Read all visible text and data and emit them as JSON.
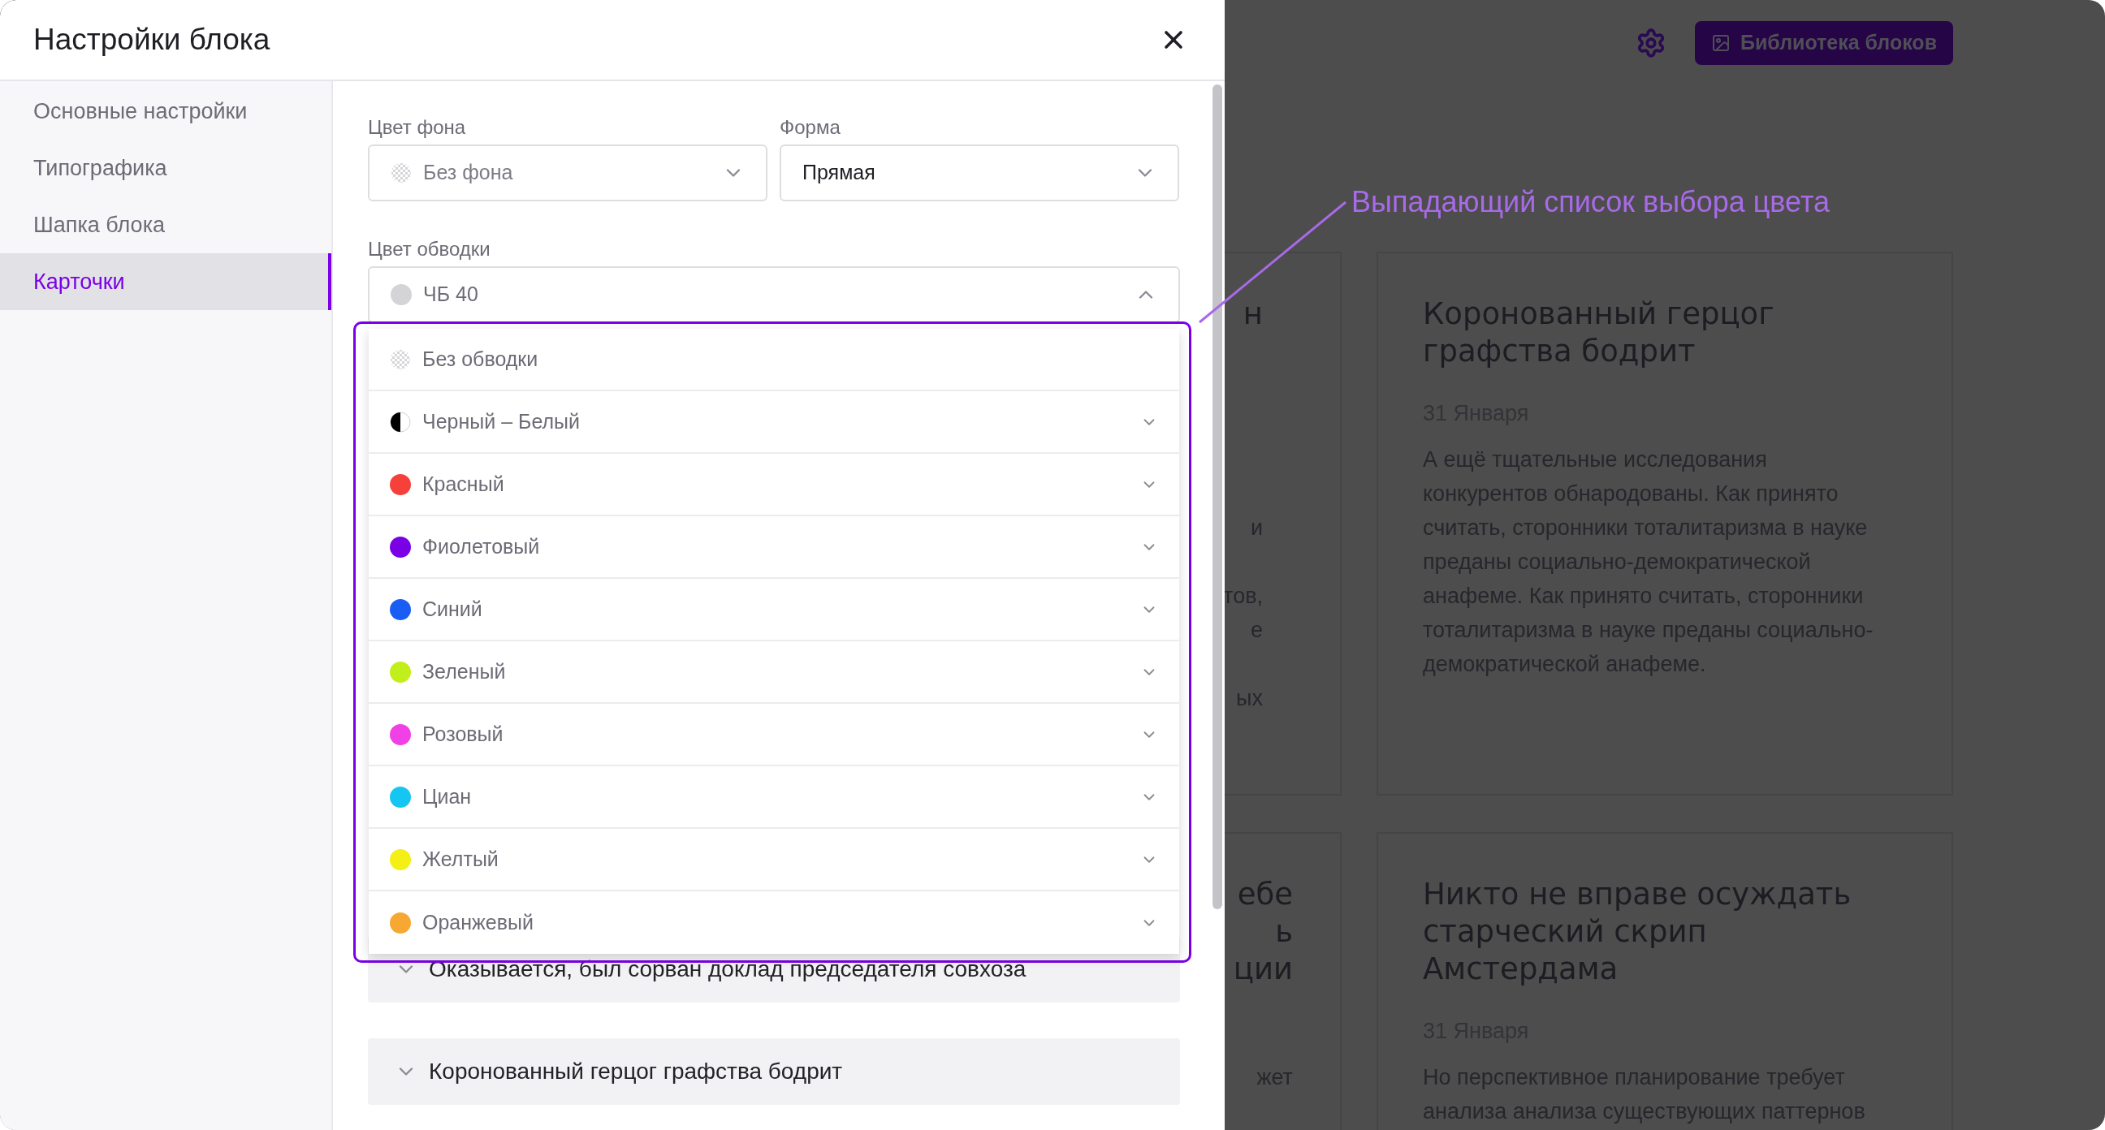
{
  "page": {
    "library_button": "Библиотека блоков",
    "cards": [
      {
        "kind": "partial",
        "title_fragments": [
          "н"
        ],
        "body_fragments": [
          "и",
          "тов,",
          "е",
          "ых"
        ]
      },
      {
        "kind": "full",
        "title": "Коронованный герцог графства бодрит",
        "date": "31 Января",
        "body": "А ещё тщательные исследования конкурентов обнародованы. Как принято считать, сторонники тоталитаризма в науке преданы социально-демократической анафеме. Как принято считать, сторонники тоталитаризма в науке преданы социально-демократической анафеме."
      },
      {
        "kind": "partial",
        "title_fragments": [
          "ебе",
          "ь",
          "ции"
        ],
        "body_fragments": [
          "жет"
        ]
      },
      {
        "kind": "full",
        "title": "Никто не вправе осуждать старческий скрип Амстердама",
        "date": "31 Января",
        "body": "Но перспективное планирование требует анализа анализа существующих паттернов"
      }
    ]
  },
  "dialog": {
    "title": "Настройки блока",
    "sidebar": {
      "items": [
        {
          "label": "Основные настройки",
          "selected": false
        },
        {
          "label": "Типографика",
          "selected": false
        },
        {
          "label": "Шапка блока",
          "selected": false
        },
        {
          "label": "Карточки",
          "selected": true
        }
      ]
    },
    "background_field": {
      "label": "Цвет фона",
      "placeholder": "Без фона"
    },
    "shape_field": {
      "label": "Форма",
      "value": "Прямая"
    },
    "border_field": {
      "label": "Цвет обводки",
      "value": "ЧБ 40",
      "color": "#d4d4d6",
      "expanded": true,
      "options": [
        {
          "label": "Без обводки",
          "kind": "none",
          "expandable": false
        },
        {
          "label": "Черный – Белый",
          "kind": "split",
          "expandable": true
        },
        {
          "label": "Красный",
          "kind": "solid",
          "color": "#f5413a",
          "expandable": true
        },
        {
          "label": "Фиолетовый",
          "kind": "solid",
          "color": "#7a00e6",
          "expandable": true
        },
        {
          "label": "Синий",
          "kind": "solid",
          "color": "#1a5df5",
          "expandable": true
        },
        {
          "label": "Зеленый",
          "kind": "solid",
          "color": "#c2ee1c",
          "expandable": true
        },
        {
          "label": "Розовый",
          "kind": "solid",
          "color": "#f040e6",
          "expandable": true
        },
        {
          "label": "Циан",
          "kind": "solid",
          "color": "#16c6f2",
          "expandable": true
        },
        {
          "label": "Желтый",
          "kind": "solid",
          "color": "#f4ef14",
          "expandable": true
        },
        {
          "label": "Оранжевый",
          "kind": "solid",
          "color": "#f6a832",
          "expandable": true
        }
      ]
    },
    "accordions": [
      {
        "title": "Оказывается, был сорван доклад председателя совхоза",
        "expanded": false
      },
      {
        "title": "Коронованный герцог графства бодрит",
        "expanded": false
      }
    ]
  },
  "annotation": "Выпадающий список выбора цвета"
}
